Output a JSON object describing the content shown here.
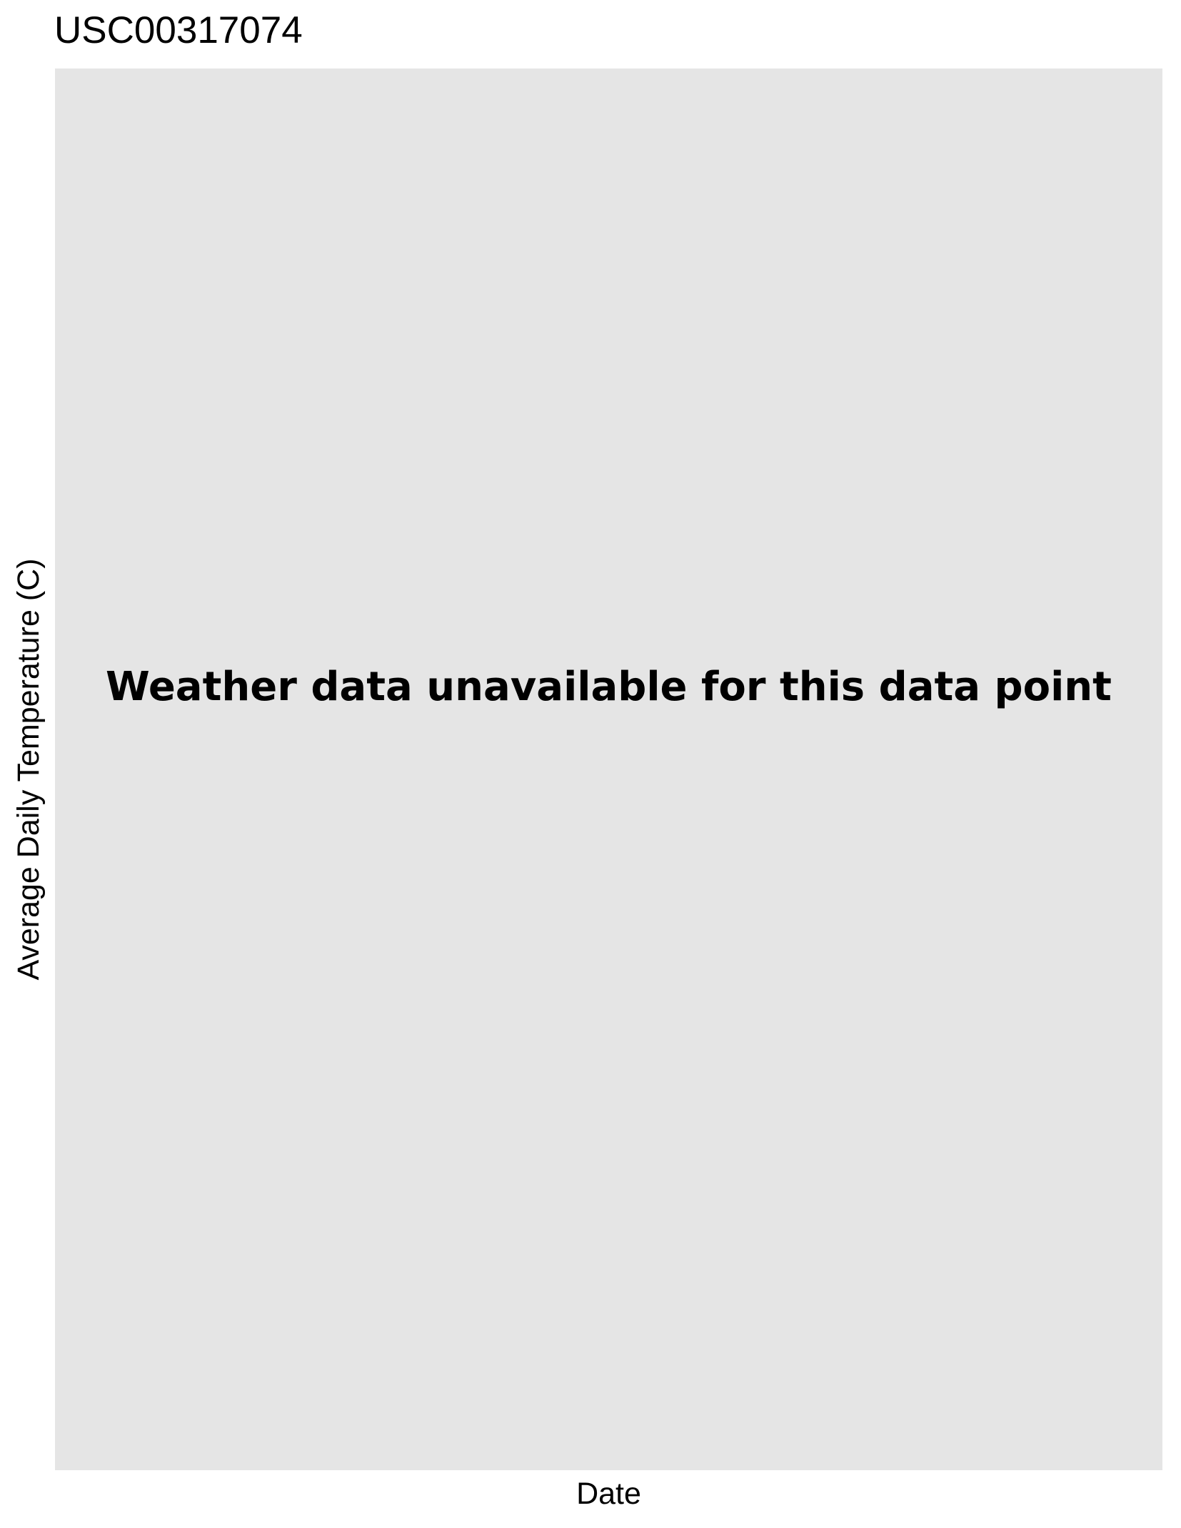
{
  "chart_data": {
    "type": "line",
    "title": "USC00317074",
    "xlabel": "Date",
    "ylabel": "Average Daily Temperature (C)",
    "series": [],
    "grid": false,
    "message": "Weather data unavailable for this data point"
  },
  "colors": {
    "panel_background": "#e5e5e5",
    "page_background": "#ffffff",
    "text": "#000000"
  }
}
